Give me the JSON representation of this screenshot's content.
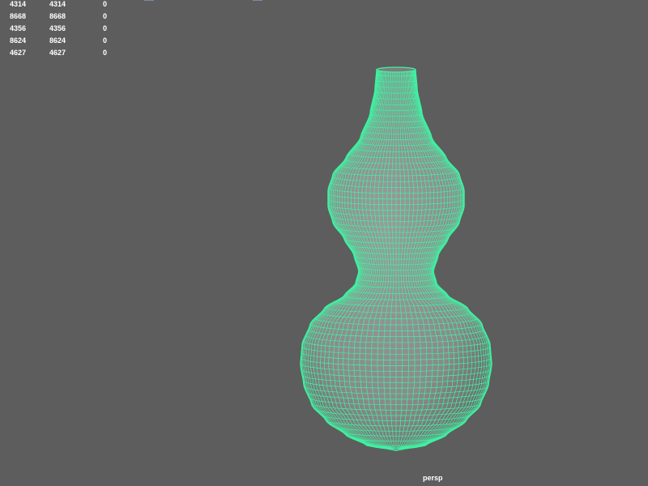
{
  "viewport": {
    "background": "#5d5d5d",
    "camera_label": "persp"
  },
  "hud": {
    "rows": [
      [
        "4314",
        "4314",
        "0"
      ],
      [
        "8668",
        "8668",
        "0"
      ],
      [
        "4356",
        "4356",
        "0"
      ],
      [
        "8624",
        "8624",
        "0"
      ],
      [
        "4627",
        "4627",
        "0"
      ]
    ]
  },
  "mesh": {
    "object": "gourd-vase",
    "wire_color": "#3ff2a2",
    "fill_color": "#8e8e8e"
  }
}
